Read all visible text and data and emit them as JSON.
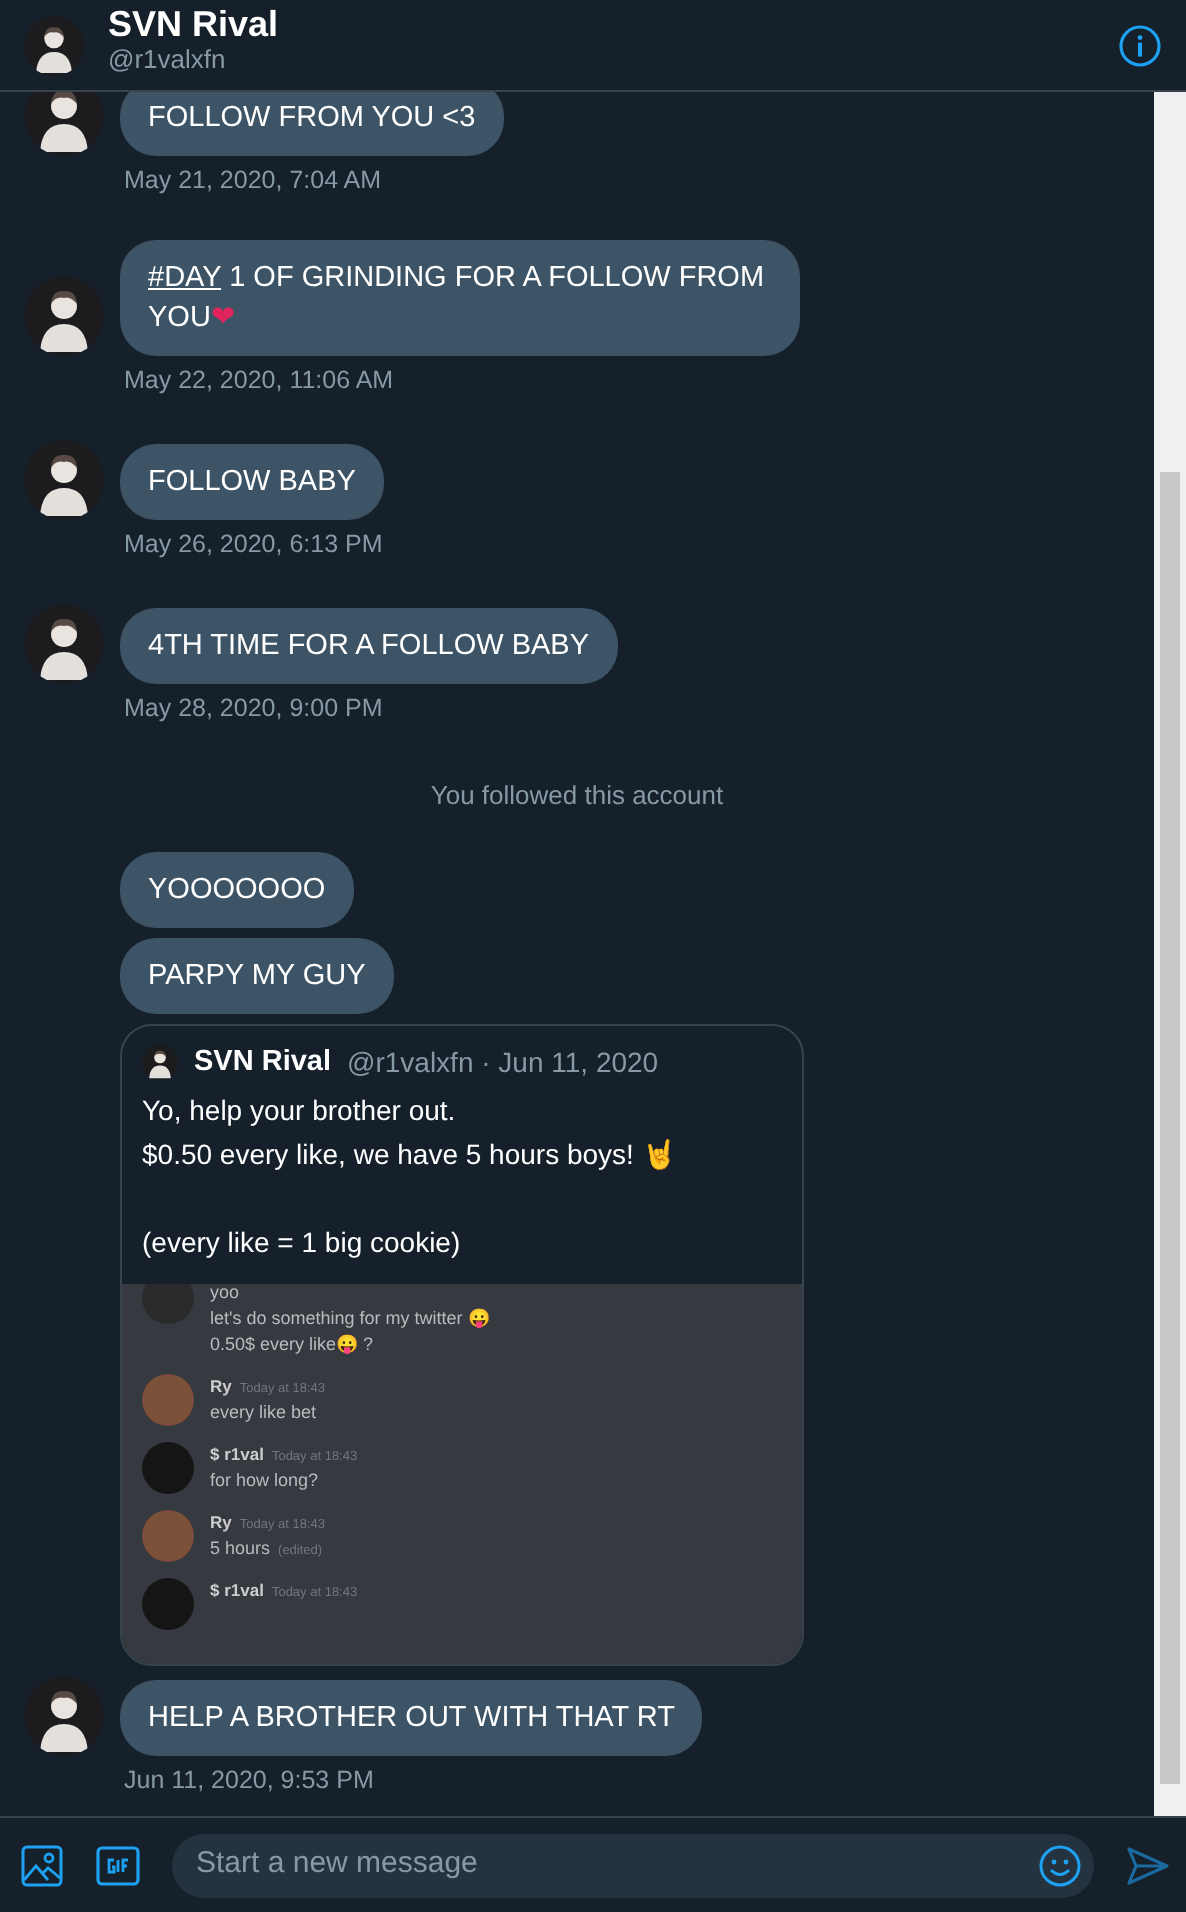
{
  "header": {
    "name": "SVN Rival",
    "handle": "@r1valxfn"
  },
  "messages": [
    {
      "kind": "text",
      "avatar": true,
      "parts": [
        {
          "text": "FOLLOW FROM YOU <3"
        }
      ],
      "time": "May 21, 2020, 7:04 AM"
    },
    {
      "kind": "text",
      "avatar": true,
      "parts": [
        {
          "text": "#DAY",
          "kind": "hashtag"
        },
        {
          "text": " 1 OF GRINDING FOR A FOLLOW FROM YOU"
        },
        {
          "text": "❤",
          "kind": "emoji",
          "color": "#e0245e"
        }
      ],
      "time": "May 22, 2020, 11:06 AM"
    },
    {
      "kind": "text",
      "avatar": true,
      "parts": [
        {
          "text": "FOLLOW BABY"
        }
      ],
      "time": "May 26, 2020, 6:13 PM"
    },
    {
      "kind": "text",
      "avatar": true,
      "parts": [
        {
          "text": "4TH TIME FOR A FOLLOW BABY"
        }
      ],
      "time": "May 28, 2020, 9:00 PM"
    },
    {
      "kind": "notice",
      "text": "You followed this account"
    },
    {
      "kind": "text",
      "avatar": false,
      "parts": [
        {
          "text": "YOOOOOOO"
        }
      ]
    },
    {
      "kind": "text",
      "avatar": false,
      "parts": [
        {
          "text": "PARPY MY GUY"
        }
      ]
    },
    {
      "kind": "tweet",
      "avatar": false,
      "name": "SVN Rival",
      "meta": "@r1valxfn · Jun 11, 2020",
      "paragraphs": [
        [
          "Yo, help your brother out.",
          "$0.50 every like, we have 5 hours boys! 🤘"
        ],
        [
          "(every like = 1 big cookie)"
        ]
      ],
      "screenshot": [
        {
          "lines": [
            "yoo",
            "let's do something for my twitter 😛",
            "0.50$ every like😛 ?"
          ]
        },
        {
          "name": "Ry",
          "time": "Today at 18:43",
          "lines": [
            "every like bet"
          ]
        },
        {
          "name": "$ r1val",
          "time": "Today at 18:43",
          "lines": [
            "for how long?"
          ]
        },
        {
          "name": "Ry",
          "time": "Today at 18:43",
          "lines": [
            "5 hours"
          ],
          "note": "(edited)"
        },
        {
          "name": "$ r1val",
          "time": "Today at 18:43"
        }
      ]
    },
    {
      "kind": "text",
      "avatar": true,
      "parts": [
        {
          "text": "HELP A BROTHER OUT WITH THAT RT"
        }
      ],
      "time": "Jun 11, 2020, 9:53 PM"
    }
  ],
  "composer": {
    "placeholder": "Start a new message"
  }
}
